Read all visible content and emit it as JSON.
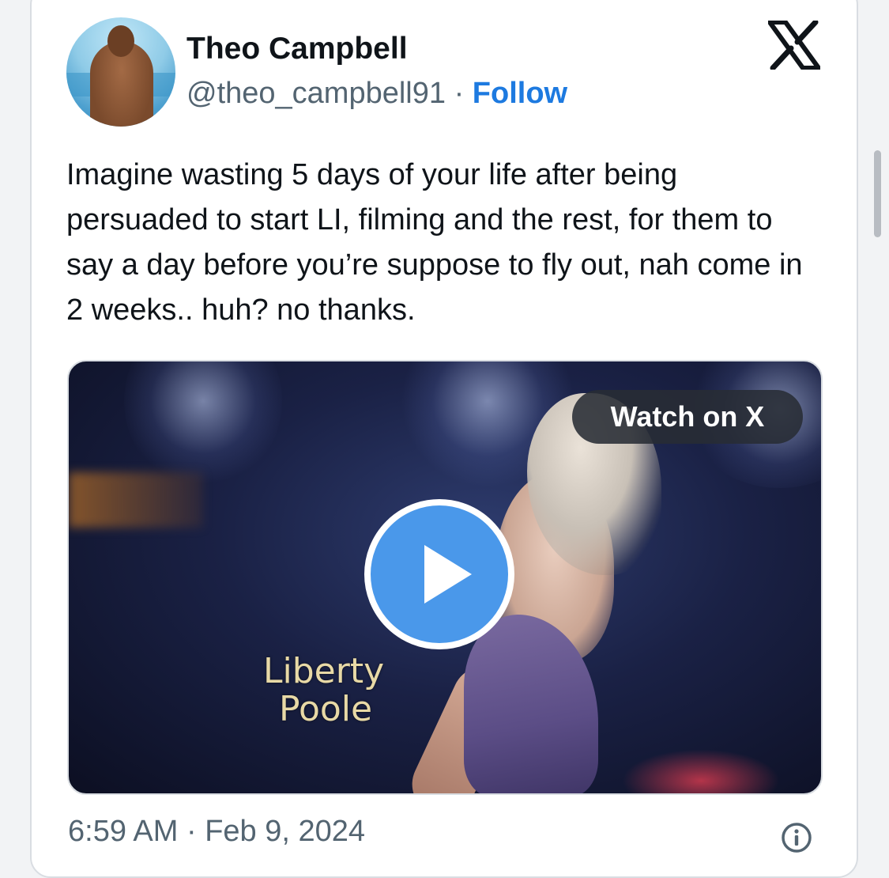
{
  "tweet": {
    "author_name": "Theo Campbell",
    "handle": "@theo_campbell91",
    "separator": "·",
    "follow_label": "Follow",
    "text": "Imagine wasting 5 days of your life after being persuaded to start LI, filming and the rest, for them to say a day before you’re suppose to fly out, nah come in 2 weeks.. huh? no thanks.",
    "timestamp": "6:59 AM · Feb 9, 2024"
  },
  "media": {
    "watch_label": "Watch on X",
    "overlay_line1": "Liberty",
    "overlay_line2": "Poole",
    "play_icon": "play-icon"
  },
  "icons": {
    "brand": "x-logo-icon",
    "info": "info-icon"
  },
  "colors": {
    "follow": "#1d7ae0",
    "play_button": "#4a98ea",
    "text_primary": "#0f1419",
    "text_secondary": "#536471"
  }
}
